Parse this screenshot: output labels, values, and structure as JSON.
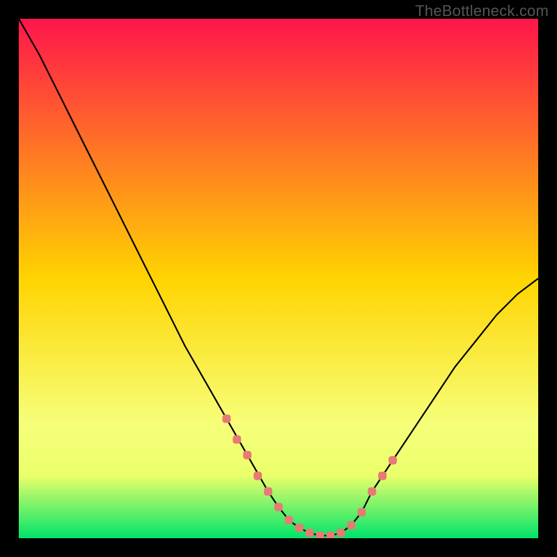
{
  "watermark": "TheBottleneck.com",
  "colors": {
    "frame": "#000000",
    "gradient_top": "#ff154b",
    "gradient_mid": "#ffd400",
    "gradient_low": "#f6ff7a",
    "gradient_bottom": "#00e46a",
    "curve": "#000000",
    "markers": "#e77a74"
  },
  "chart_data": {
    "type": "line",
    "title": "",
    "xlabel": "",
    "ylabel": "",
    "xlim": [
      0,
      100
    ],
    "ylim": [
      0,
      100
    ],
    "series": [
      {
        "name": "curve",
        "x": [
          0,
          4,
          8,
          12,
          16,
          20,
          24,
          28,
          32,
          36,
          40,
          44,
          48,
          50,
          52,
          54,
          56,
          58,
          60,
          62,
          64,
          66,
          68,
          72,
          76,
          80,
          84,
          88,
          92,
          96,
          100
        ],
        "y": [
          100,
          93,
          85,
          77,
          69,
          61,
          53,
          45,
          37,
          30,
          23,
          16,
          9,
          6,
          3.5,
          2,
          1,
          0.5,
          0.5,
          1,
          2.5,
          5,
          9,
          15,
          21,
          27,
          33,
          38,
          43,
          47,
          50
        ]
      }
    ],
    "markers": {
      "name": "highlight-points",
      "x": [
        40,
        42,
        44,
        46,
        48,
        50,
        52,
        54,
        56,
        58,
        60,
        62,
        64,
        66,
        68,
        70,
        72
      ],
      "y": [
        23,
        19,
        16,
        12,
        9,
        6,
        3.5,
        2,
        1,
        0.5,
        0.5,
        1,
        2.5,
        5,
        9,
        12,
        15
      ]
    }
  }
}
